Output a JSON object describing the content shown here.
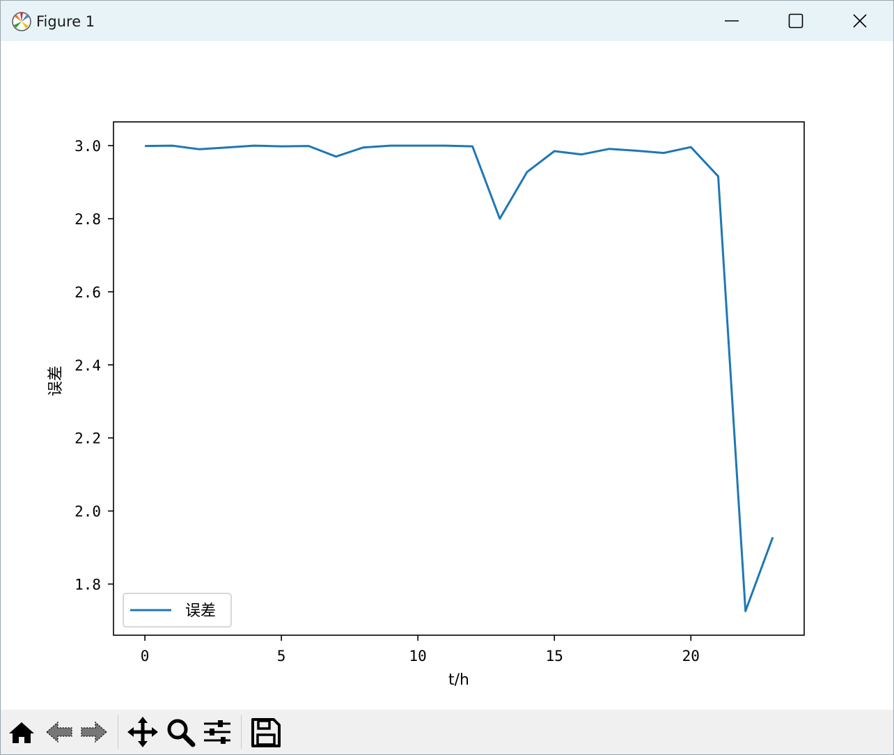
{
  "window": {
    "title": "Figure 1"
  },
  "toolbar": {
    "buttons": [
      {
        "name": "home-button",
        "icon": "home-icon"
      },
      {
        "name": "back-button",
        "icon": "back-arrow-icon"
      },
      {
        "name": "forward-button",
        "icon": "forward-arrow-icon"
      },
      {
        "name": "pan-button",
        "icon": "move-icon"
      },
      {
        "name": "zoom-button",
        "icon": "magnifier-icon"
      },
      {
        "name": "configure-subplots-button",
        "icon": "sliders-icon"
      },
      {
        "name": "save-button",
        "icon": "floppy-disk-icon"
      }
    ]
  },
  "chart_data": {
    "type": "line",
    "title": "",
    "xlabel": "t/h",
    "ylabel": "误差",
    "xlim": [
      -1.15,
      24.15
    ],
    "ylim": [
      1.66,
      3.065
    ],
    "xticks": [
      0,
      5,
      10,
      15,
      20
    ],
    "xtick_labels": [
      "0",
      "5",
      "10",
      "15",
      "20"
    ],
    "yticks": [
      1.8,
      2.0,
      2.2,
      2.4,
      2.6,
      2.8,
      3.0
    ],
    "ytick_labels": [
      "1.8",
      "2.0",
      "2.2",
      "2.4",
      "2.6",
      "2.8",
      "3.0"
    ],
    "grid": false,
    "legend_position": "lower left",
    "series": [
      {
        "name": "误差",
        "color": "#1f77b4",
        "x": [
          0,
          1,
          2,
          3,
          4,
          5,
          6,
          7,
          8,
          9,
          10,
          11,
          12,
          13,
          14,
          15,
          16,
          17,
          18,
          19,
          20,
          21,
          22,
          23
        ],
        "y": [
          2.999,
          3.0,
          2.99,
          2.995,
          3.0,
          2.998,
          2.999,
          2.97,
          2.995,
          3.0,
          3.0,
          3.0,
          2.998,
          2.8,
          2.928,
          2.985,
          2.976,
          2.991,
          2.986,
          2.98,
          2.996,
          2.916,
          1.726,
          1.928
        ]
      }
    ]
  }
}
